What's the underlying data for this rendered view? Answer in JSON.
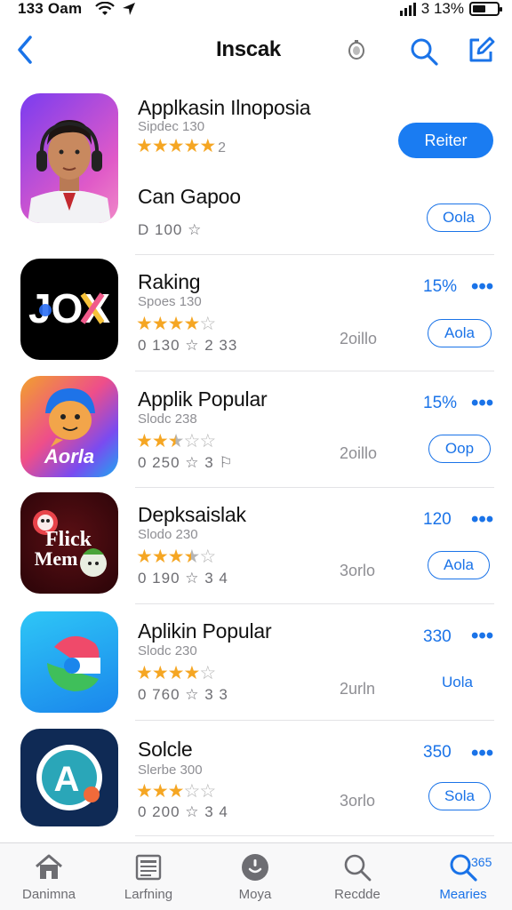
{
  "status": {
    "time": "133 Oam",
    "battery_text": "3 13%",
    "battery_fill": 0.55
  },
  "header": {
    "title": "Inscak"
  },
  "apps": [
    {
      "name": "Applkasin Ilnoposia",
      "sub": "Sipdec 130",
      "rating": 5,
      "count": "2",
      "name2": "Can Gapoo",
      "meta": "D 100  ☆",
      "button": "Reiter",
      "button2": "Oola"
    },
    {
      "name": "Raking",
      "sub": "Spoes 130",
      "rating": 4,
      "meta": "0 130  ☆ 2 33",
      "size": "2oillo",
      "pct": "15%",
      "button": "Aola"
    },
    {
      "name": "Applik Popular",
      "sub": "Slodc 238",
      "rating": 2.5,
      "meta": "0 250  ☆ 3 ⚐",
      "size": "2oillo",
      "pct": "15%",
      "button": "Oop"
    },
    {
      "name": "Depksaislak",
      "sub": "Slodo 230",
      "rating": 3.5,
      "meta": "0 190  ☆ 3 4",
      "size": "3orlo",
      "pct": "120",
      "button": "Aola"
    },
    {
      "name": "Aplikin Popular",
      "sub": "Slodc 230",
      "rating": 4,
      "meta": "0 760  ☆ 3 3",
      "size": "2urln",
      "pct": "330",
      "button": "Uola"
    },
    {
      "name": "Solcle",
      "sub": "Slerbe 300",
      "rating": 3,
      "meta": "0 200  ☆ 3 4",
      "size": "3orlo",
      "pct": "350",
      "button": "Sola"
    }
  ],
  "icon_texts": {
    "jox": "JOX",
    "aorla": "Aorla",
    "flick": "Flick",
    "mem": "Mem",
    "a_logo": "A"
  },
  "tabs": [
    {
      "label": "Danimna",
      "icon": "home-icon"
    },
    {
      "label": "Larfning",
      "icon": "news-icon"
    },
    {
      "label": "Moya",
      "icon": "games-icon"
    },
    {
      "label": "Recdde",
      "icon": "search-icon"
    },
    {
      "label": "Mearies",
      "icon": "search-icon"
    }
  ],
  "tab_badge": "365",
  "colors": {
    "accent": "#1a73e8",
    "star": "#f5a623"
  }
}
